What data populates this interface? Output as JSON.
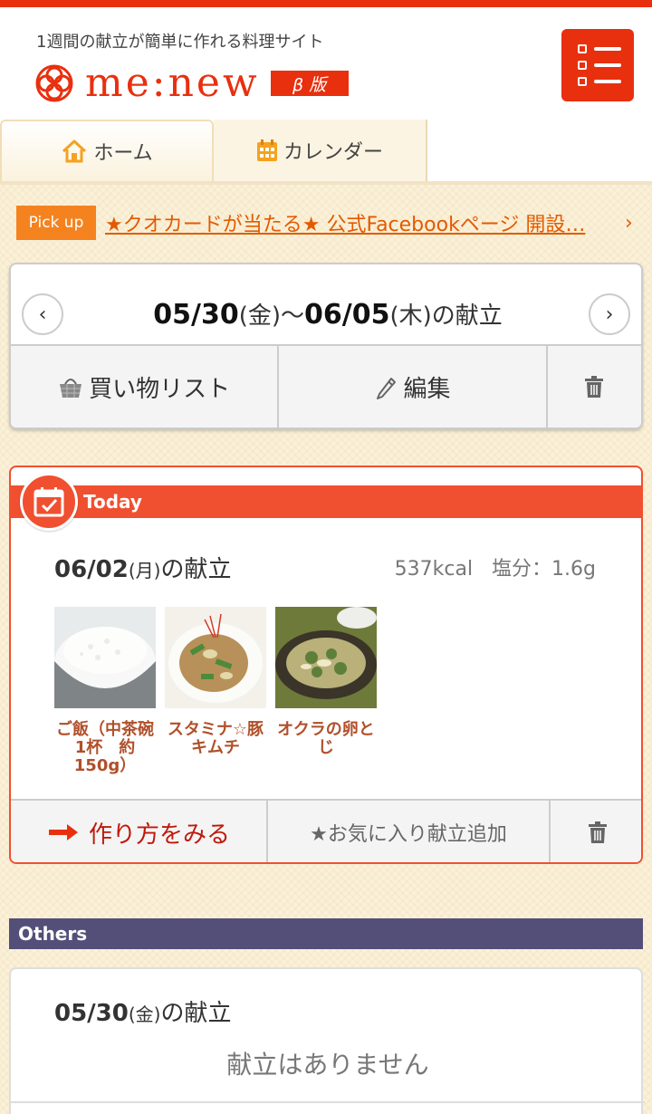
{
  "brand": {
    "tagline": "1週間の献立が簡単に作れる料理サイト",
    "name": "me:new",
    "beta": "β 版",
    "color": "#e8300f"
  },
  "nav": {
    "home": "ホーム",
    "calendar": "カレンダー"
  },
  "pickup": {
    "badge": "Pick up",
    "text": "★クオカードが当たる★ 公式Facebookページ 開設…",
    "arrow": "›"
  },
  "week": {
    "start_date": "05/30",
    "start_dow": "(金)",
    "separator": "〜",
    "end_date": "06/05",
    "end_dow": "(木)",
    "suffix": "の献立",
    "prev": "‹",
    "next": "›",
    "shopping_list": "買い物リスト",
    "edit": "編集"
  },
  "today": {
    "label": "Today",
    "date": "06/02",
    "dow": "(月)",
    "suffix": "の献立",
    "kcal": "537kcal",
    "salt": "塩分：1.6g",
    "dishes": [
      {
        "name": "ご飯（中茶碗1杯　約150g）",
        "line1": "ご飯（中茶碗",
        "line2": "1杯　約",
        "line3": "150g）"
      },
      {
        "name": "スタミナ☆豚キムチ",
        "line1": "スタミナ☆豚",
        "line2": "キムチ",
        "line3": ""
      },
      {
        "name": "オクラの卵とじ",
        "line1": "オクラの卵と",
        "line2": "じ",
        "line3": ""
      }
    ],
    "recipe_button": "作り方をみる",
    "favorite_button": "★お気に入り献立追加"
  },
  "others": {
    "label": "Others",
    "date": "05/30",
    "dow": "(金)",
    "suffix": "の献立",
    "empty": "献立はありません"
  },
  "colors": {
    "accent": "#e8300f",
    "today": "#f05030",
    "others": "#534f79",
    "pickup": "#f4831f"
  }
}
